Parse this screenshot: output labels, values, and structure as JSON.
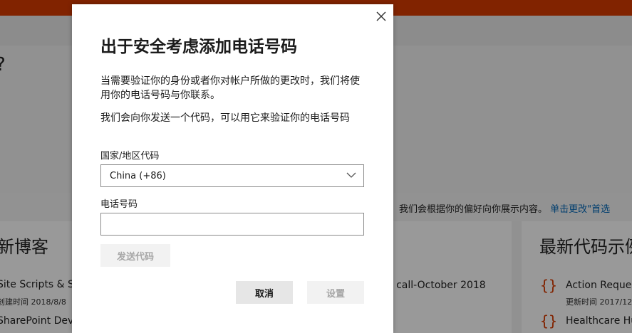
{
  "background": {
    "hero_question": "?",
    "notice": {
      "text": "我们会根据你的偏好向你展示内容。",
      "link": "单击更改\"首选"
    },
    "cards": [
      {
        "title": "新博客",
        "items": [
          {
            "title": "Site Scripts & Sit",
            "date": "创建时间 2018/8/8"
          },
          {
            "title": "SharePoint Dev"
          }
        ]
      },
      {
        "items": [
          {
            "title": "ity call-October 2018"
          }
        ]
      },
      {
        "title": "最新代码示例",
        "items": [
          {
            "title": "Action Reques",
            "date": "更新时间 2017/12"
          },
          {
            "title": "Healthcare Hu"
          }
        ]
      }
    ],
    "colors": {
      "brand": "#d83b01",
      "link": "#0067b8"
    }
  },
  "dialog": {
    "close_icon": "close-icon",
    "title": "出于安全考虑添加电话号码",
    "paragraph1": "当需要验证你的身份或者你对帐户所做的更改时，我们将使用你的电话号码与你联系。",
    "paragraph2": "我们会向你发送一个代码，可以用它来验证你的电话号码",
    "country_label": "国家/地区代码",
    "country_value": "China (+86)",
    "phone_label": "电话号码",
    "phone_value": "",
    "send_code_label": "发送代码",
    "cancel_label": "取消",
    "settings_label": "设置"
  }
}
